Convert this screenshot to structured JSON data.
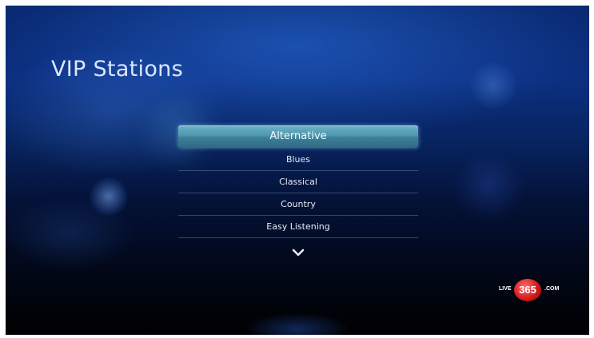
{
  "screen": {
    "title": "VIP Stations"
  },
  "station_list": {
    "items": [
      {
        "label": "Alternative",
        "selected": true
      },
      {
        "label": "Blues",
        "selected": false
      },
      {
        "label": "Classical",
        "selected": false
      },
      {
        "label": "Country",
        "selected": false
      },
      {
        "label": "Easy Listening",
        "selected": false
      }
    ],
    "more_icon": "chevron-down-icon"
  },
  "branding": {
    "logo_prefix": "LIVE",
    "logo_number": "365",
    "logo_suffix": ".COM"
  },
  "colors": {
    "selection_highlight": "#4f97ad",
    "logo_red": "#d01818",
    "title_text": "#dbe6ff"
  }
}
